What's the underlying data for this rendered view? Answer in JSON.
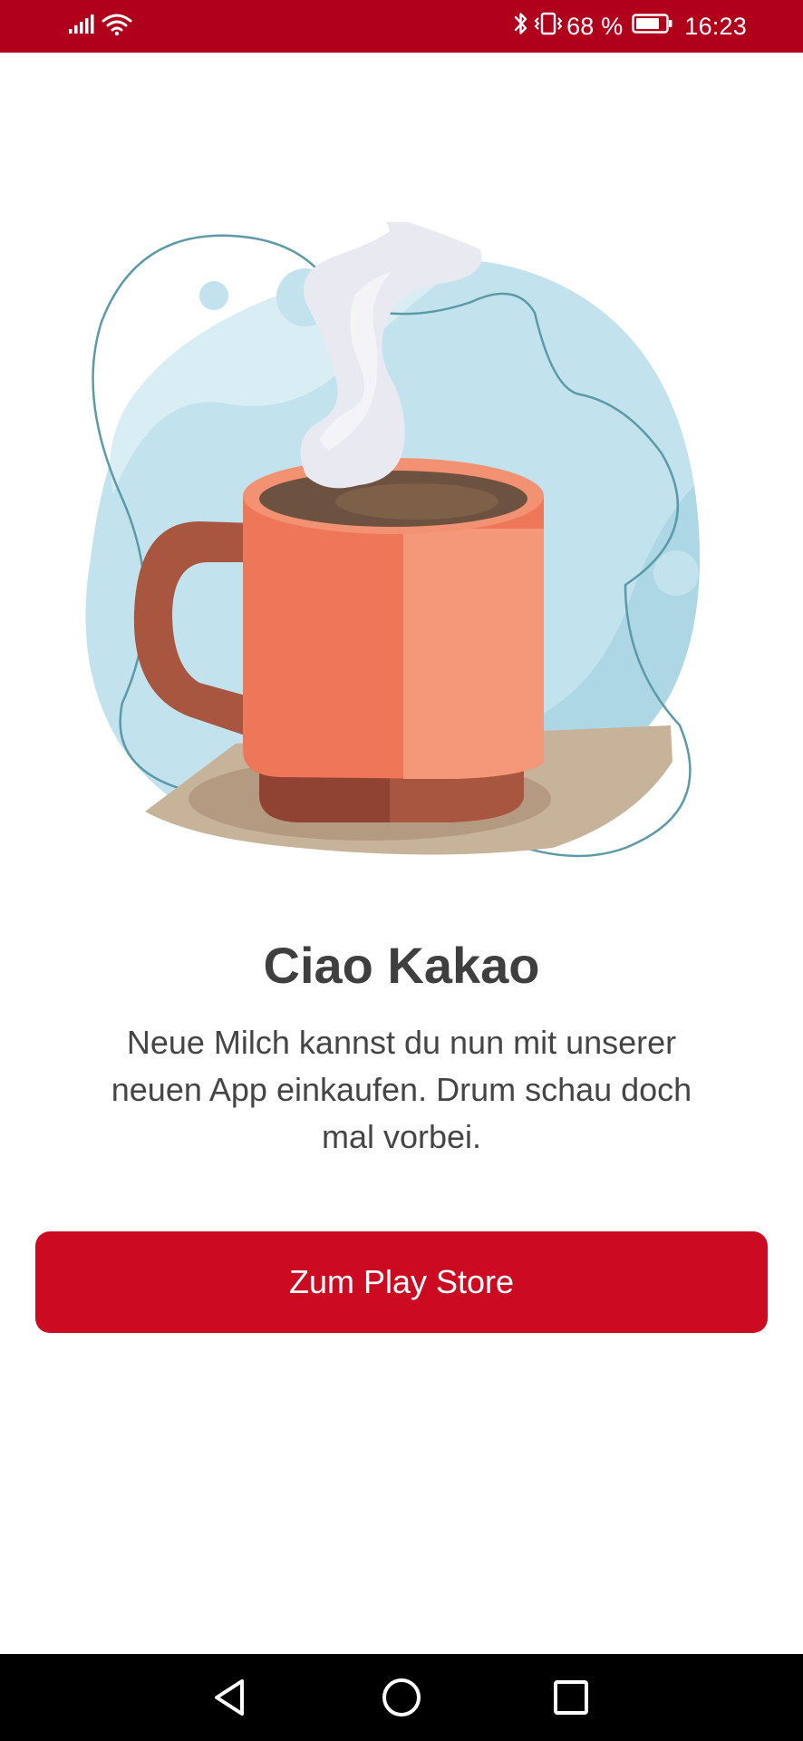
{
  "status_bar": {
    "battery_percent": "68 %",
    "time": "16:23",
    "background_color": "#b0001b",
    "icons": [
      "signal-icon",
      "wifi-icon",
      "bluetooth-icon",
      "vibrate-icon",
      "battery-icon"
    ]
  },
  "illustration": {
    "name": "cocoa-mug-illustration"
  },
  "content": {
    "title": "Ciao Kakao",
    "message": "Neue Milch kannst du nun mit unserer neuen App einkaufen. Drum schau doch mal vorbei."
  },
  "cta": {
    "label": "Zum Play Store",
    "color": "#cc0a22"
  },
  "navigation_bar": {
    "icons": [
      "back-icon",
      "home-icon",
      "recents-icon"
    ]
  }
}
